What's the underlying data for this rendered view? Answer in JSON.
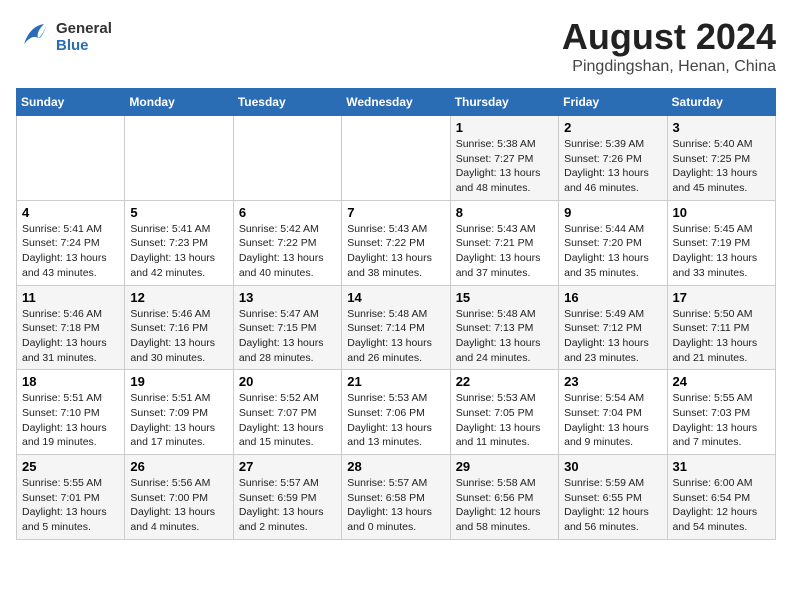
{
  "logo": {
    "general": "General",
    "blue": "Blue"
  },
  "title": "August 2024",
  "subtitle": "Pingdingshan, Henan, China",
  "days_of_week": [
    "Sunday",
    "Monday",
    "Tuesday",
    "Wednesday",
    "Thursday",
    "Friday",
    "Saturday"
  ],
  "weeks": [
    [
      {
        "day": "",
        "info": ""
      },
      {
        "day": "",
        "info": ""
      },
      {
        "day": "",
        "info": ""
      },
      {
        "day": "",
        "info": ""
      },
      {
        "day": "1",
        "info": "Sunrise: 5:38 AM\nSunset: 7:27 PM\nDaylight: 13 hours\nand 48 minutes."
      },
      {
        "day": "2",
        "info": "Sunrise: 5:39 AM\nSunset: 7:26 PM\nDaylight: 13 hours\nand 46 minutes."
      },
      {
        "day": "3",
        "info": "Sunrise: 5:40 AM\nSunset: 7:25 PM\nDaylight: 13 hours\nand 45 minutes."
      }
    ],
    [
      {
        "day": "4",
        "info": "Sunrise: 5:41 AM\nSunset: 7:24 PM\nDaylight: 13 hours\nand 43 minutes."
      },
      {
        "day": "5",
        "info": "Sunrise: 5:41 AM\nSunset: 7:23 PM\nDaylight: 13 hours\nand 42 minutes."
      },
      {
        "day": "6",
        "info": "Sunrise: 5:42 AM\nSunset: 7:22 PM\nDaylight: 13 hours\nand 40 minutes."
      },
      {
        "day": "7",
        "info": "Sunrise: 5:43 AM\nSunset: 7:22 PM\nDaylight: 13 hours\nand 38 minutes."
      },
      {
        "day": "8",
        "info": "Sunrise: 5:43 AM\nSunset: 7:21 PM\nDaylight: 13 hours\nand 37 minutes."
      },
      {
        "day": "9",
        "info": "Sunrise: 5:44 AM\nSunset: 7:20 PM\nDaylight: 13 hours\nand 35 minutes."
      },
      {
        "day": "10",
        "info": "Sunrise: 5:45 AM\nSunset: 7:19 PM\nDaylight: 13 hours\nand 33 minutes."
      }
    ],
    [
      {
        "day": "11",
        "info": "Sunrise: 5:46 AM\nSunset: 7:18 PM\nDaylight: 13 hours\nand 31 minutes."
      },
      {
        "day": "12",
        "info": "Sunrise: 5:46 AM\nSunset: 7:16 PM\nDaylight: 13 hours\nand 30 minutes."
      },
      {
        "day": "13",
        "info": "Sunrise: 5:47 AM\nSunset: 7:15 PM\nDaylight: 13 hours\nand 28 minutes."
      },
      {
        "day": "14",
        "info": "Sunrise: 5:48 AM\nSunset: 7:14 PM\nDaylight: 13 hours\nand 26 minutes."
      },
      {
        "day": "15",
        "info": "Sunrise: 5:48 AM\nSunset: 7:13 PM\nDaylight: 13 hours\nand 24 minutes."
      },
      {
        "day": "16",
        "info": "Sunrise: 5:49 AM\nSunset: 7:12 PM\nDaylight: 13 hours\nand 23 minutes."
      },
      {
        "day": "17",
        "info": "Sunrise: 5:50 AM\nSunset: 7:11 PM\nDaylight: 13 hours\nand 21 minutes."
      }
    ],
    [
      {
        "day": "18",
        "info": "Sunrise: 5:51 AM\nSunset: 7:10 PM\nDaylight: 13 hours\nand 19 minutes."
      },
      {
        "day": "19",
        "info": "Sunrise: 5:51 AM\nSunset: 7:09 PM\nDaylight: 13 hours\nand 17 minutes."
      },
      {
        "day": "20",
        "info": "Sunrise: 5:52 AM\nSunset: 7:07 PM\nDaylight: 13 hours\nand 15 minutes."
      },
      {
        "day": "21",
        "info": "Sunrise: 5:53 AM\nSunset: 7:06 PM\nDaylight: 13 hours\nand 13 minutes."
      },
      {
        "day": "22",
        "info": "Sunrise: 5:53 AM\nSunset: 7:05 PM\nDaylight: 13 hours\nand 11 minutes."
      },
      {
        "day": "23",
        "info": "Sunrise: 5:54 AM\nSunset: 7:04 PM\nDaylight: 13 hours\nand 9 minutes."
      },
      {
        "day": "24",
        "info": "Sunrise: 5:55 AM\nSunset: 7:03 PM\nDaylight: 13 hours\nand 7 minutes."
      }
    ],
    [
      {
        "day": "25",
        "info": "Sunrise: 5:55 AM\nSunset: 7:01 PM\nDaylight: 13 hours\nand 5 minutes."
      },
      {
        "day": "26",
        "info": "Sunrise: 5:56 AM\nSunset: 7:00 PM\nDaylight: 13 hours\nand 4 minutes."
      },
      {
        "day": "27",
        "info": "Sunrise: 5:57 AM\nSunset: 6:59 PM\nDaylight: 13 hours\nand 2 minutes."
      },
      {
        "day": "28",
        "info": "Sunrise: 5:57 AM\nSunset: 6:58 PM\nDaylight: 13 hours\nand 0 minutes."
      },
      {
        "day": "29",
        "info": "Sunrise: 5:58 AM\nSunset: 6:56 PM\nDaylight: 12 hours\nand 58 minutes."
      },
      {
        "day": "30",
        "info": "Sunrise: 5:59 AM\nSunset: 6:55 PM\nDaylight: 12 hours\nand 56 minutes."
      },
      {
        "day": "31",
        "info": "Sunrise: 6:00 AM\nSunset: 6:54 PM\nDaylight: 12 hours\nand 54 minutes."
      }
    ]
  ]
}
